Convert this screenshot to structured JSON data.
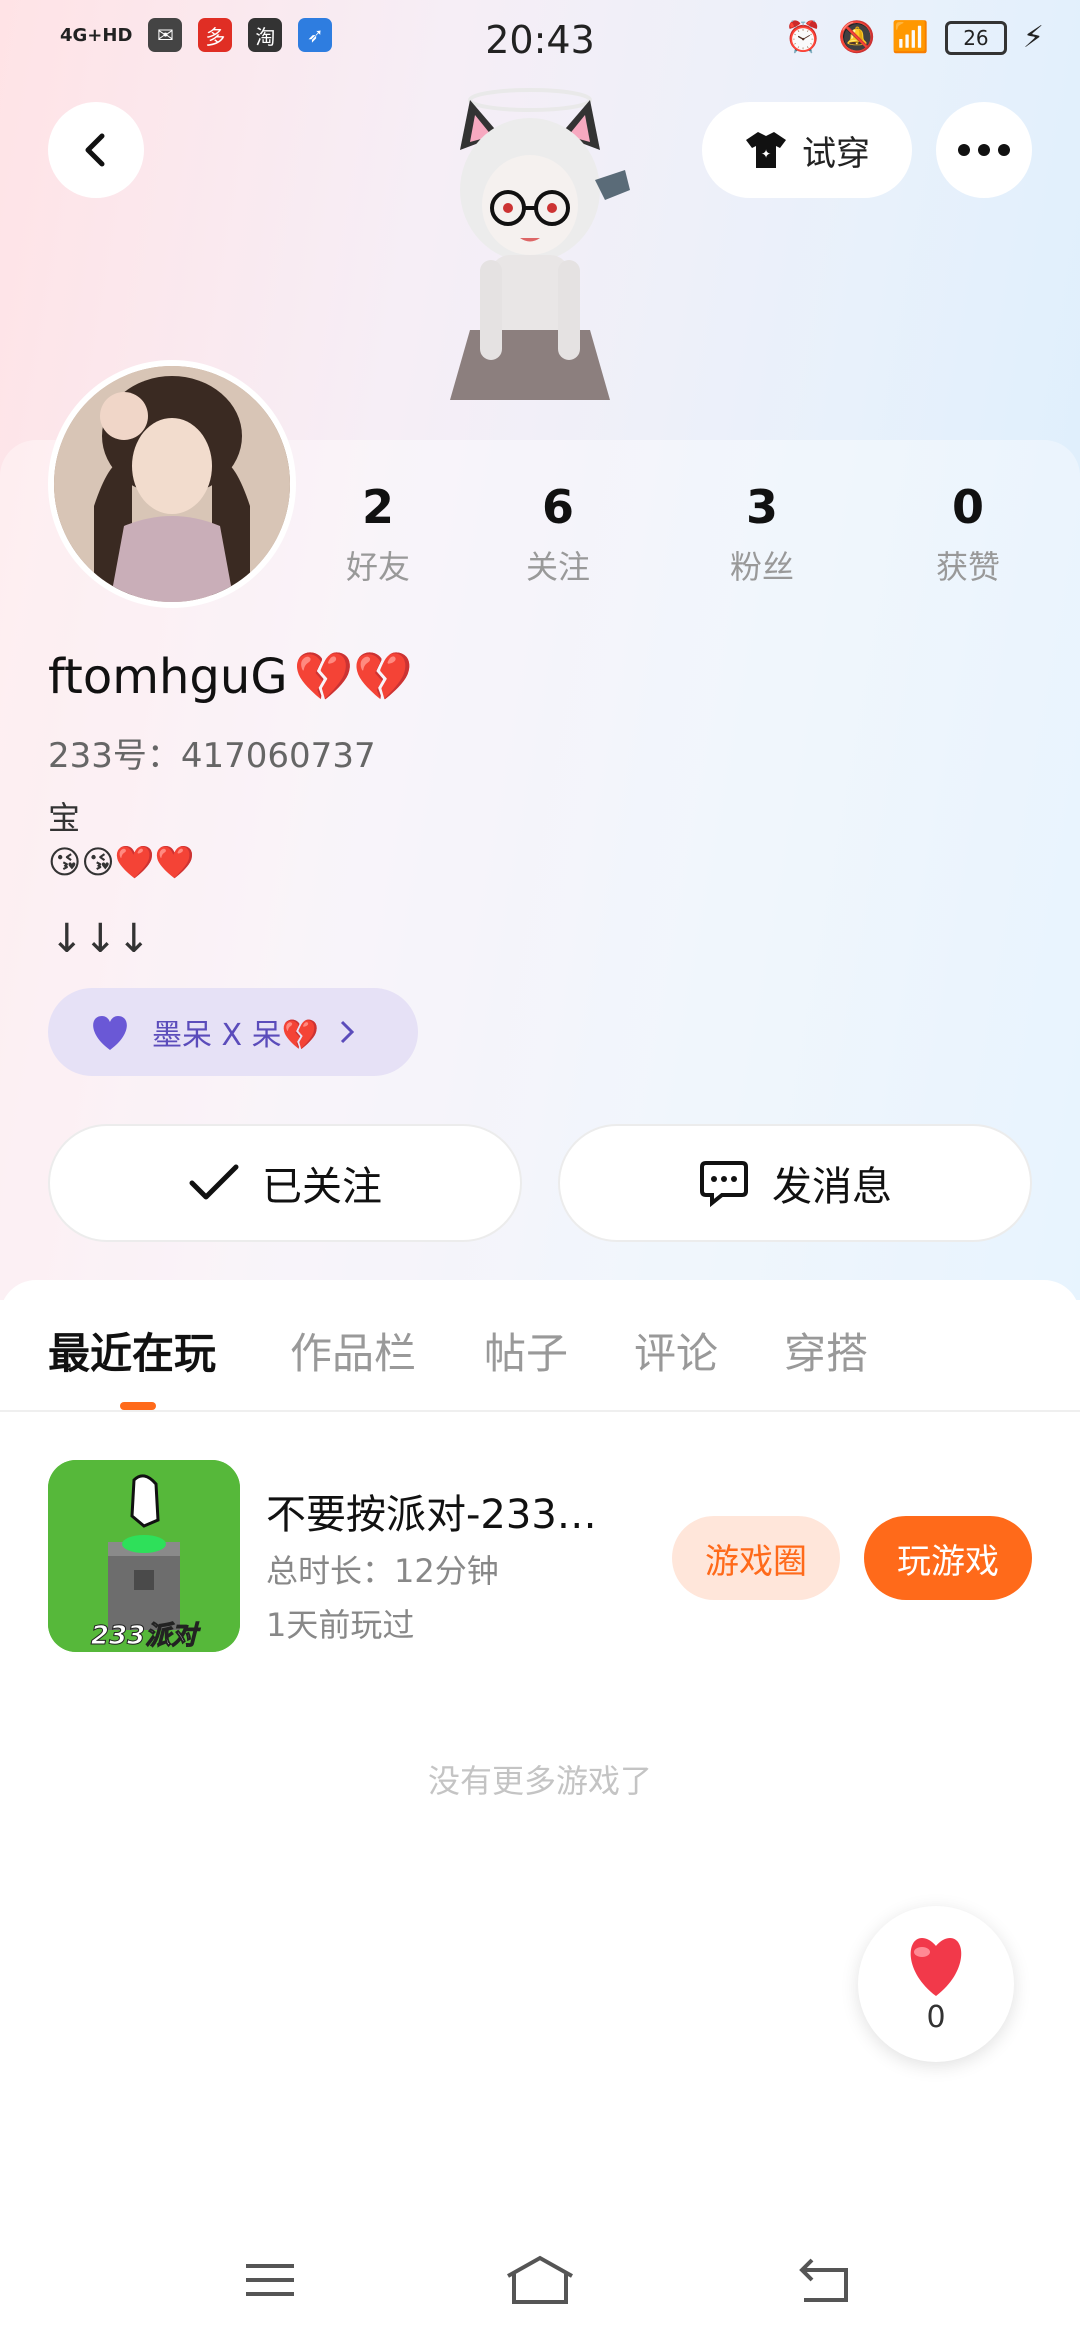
{
  "status_bar": {
    "network": "4G+HD",
    "time": "20:43",
    "battery": "26"
  },
  "header": {
    "try_on_label": "试穿"
  },
  "profile": {
    "stats": [
      {
        "value": "2",
        "label": "好友"
      },
      {
        "value": "6",
        "label": "关注"
      },
      {
        "value": "3",
        "label": "粉丝"
      },
      {
        "value": "0",
        "label": "获赞"
      }
    ],
    "username": "ftomhguG",
    "username_emoji": "💔💔",
    "uid": "233号：417060737",
    "bio_line1": "宝",
    "bio_line2": "😘😘❤️❤️",
    "arrows": "↓↓↓",
    "relation_tag": "墨呆 X 呆💔"
  },
  "actions": {
    "followed_label": "已关注",
    "message_label": "发消息"
  },
  "tabs": [
    {
      "label": "最近在玩"
    },
    {
      "label": "作品栏"
    },
    {
      "label": "帖子"
    },
    {
      "label": "评论"
    },
    {
      "label": "穿搭"
    }
  ],
  "recent_game": {
    "title": "不要按派对-233…",
    "thumb_badge": "233派对",
    "duration": "总时长：12分钟",
    "last_played": "1天前玩过",
    "circle_label": "游戏圈",
    "play_label": "玩游戏"
  },
  "footer": {
    "no_more": "没有更多游戏了",
    "like_count": "0"
  },
  "colors": {
    "accent": "#ff6a1a",
    "pill_bg": "#e6e1f6",
    "pill_text": "#5b4cbb"
  }
}
